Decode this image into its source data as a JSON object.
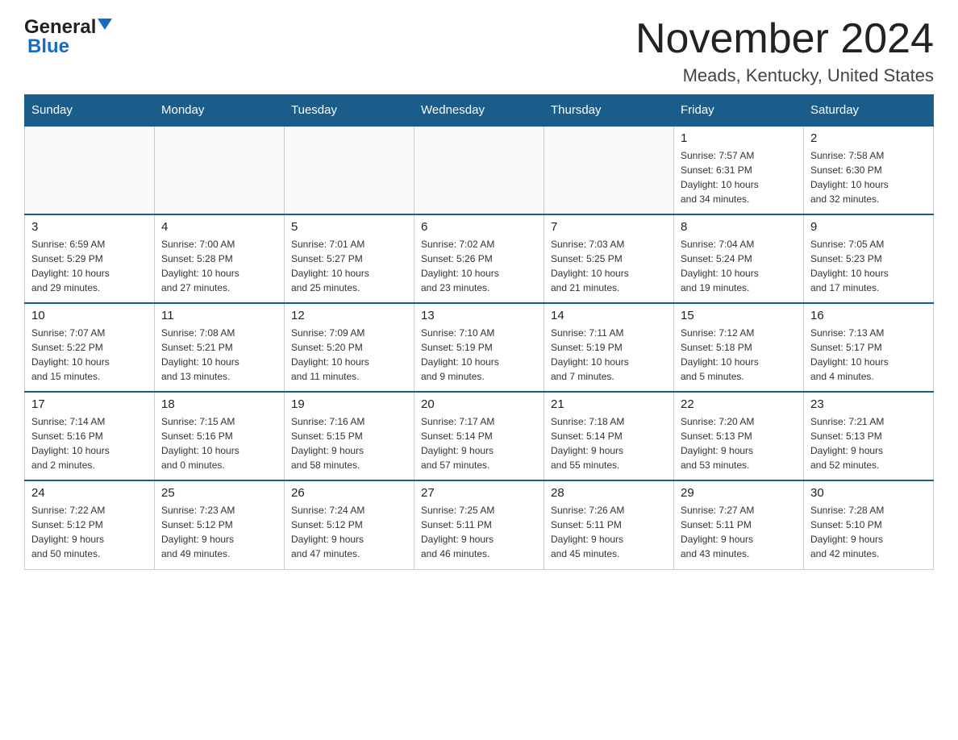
{
  "header": {
    "logo_general": "General",
    "logo_blue": "Blue",
    "main_title": "November 2024",
    "subtitle": "Meads, Kentucky, United States"
  },
  "days_of_week": [
    "Sunday",
    "Monday",
    "Tuesday",
    "Wednesday",
    "Thursday",
    "Friday",
    "Saturday"
  ],
  "weeks": [
    [
      {
        "day": "",
        "info": ""
      },
      {
        "day": "",
        "info": ""
      },
      {
        "day": "",
        "info": ""
      },
      {
        "day": "",
        "info": ""
      },
      {
        "day": "",
        "info": ""
      },
      {
        "day": "1",
        "info": "Sunrise: 7:57 AM\nSunset: 6:31 PM\nDaylight: 10 hours\nand 34 minutes."
      },
      {
        "day": "2",
        "info": "Sunrise: 7:58 AM\nSunset: 6:30 PM\nDaylight: 10 hours\nand 32 minutes."
      }
    ],
    [
      {
        "day": "3",
        "info": "Sunrise: 6:59 AM\nSunset: 5:29 PM\nDaylight: 10 hours\nand 29 minutes."
      },
      {
        "day": "4",
        "info": "Sunrise: 7:00 AM\nSunset: 5:28 PM\nDaylight: 10 hours\nand 27 minutes."
      },
      {
        "day": "5",
        "info": "Sunrise: 7:01 AM\nSunset: 5:27 PM\nDaylight: 10 hours\nand 25 minutes."
      },
      {
        "day": "6",
        "info": "Sunrise: 7:02 AM\nSunset: 5:26 PM\nDaylight: 10 hours\nand 23 minutes."
      },
      {
        "day": "7",
        "info": "Sunrise: 7:03 AM\nSunset: 5:25 PM\nDaylight: 10 hours\nand 21 minutes."
      },
      {
        "day": "8",
        "info": "Sunrise: 7:04 AM\nSunset: 5:24 PM\nDaylight: 10 hours\nand 19 minutes."
      },
      {
        "day": "9",
        "info": "Sunrise: 7:05 AM\nSunset: 5:23 PM\nDaylight: 10 hours\nand 17 minutes."
      }
    ],
    [
      {
        "day": "10",
        "info": "Sunrise: 7:07 AM\nSunset: 5:22 PM\nDaylight: 10 hours\nand 15 minutes."
      },
      {
        "day": "11",
        "info": "Sunrise: 7:08 AM\nSunset: 5:21 PM\nDaylight: 10 hours\nand 13 minutes."
      },
      {
        "day": "12",
        "info": "Sunrise: 7:09 AM\nSunset: 5:20 PM\nDaylight: 10 hours\nand 11 minutes."
      },
      {
        "day": "13",
        "info": "Sunrise: 7:10 AM\nSunset: 5:19 PM\nDaylight: 10 hours\nand 9 minutes."
      },
      {
        "day": "14",
        "info": "Sunrise: 7:11 AM\nSunset: 5:19 PM\nDaylight: 10 hours\nand 7 minutes."
      },
      {
        "day": "15",
        "info": "Sunrise: 7:12 AM\nSunset: 5:18 PM\nDaylight: 10 hours\nand 5 minutes."
      },
      {
        "day": "16",
        "info": "Sunrise: 7:13 AM\nSunset: 5:17 PM\nDaylight: 10 hours\nand 4 minutes."
      }
    ],
    [
      {
        "day": "17",
        "info": "Sunrise: 7:14 AM\nSunset: 5:16 PM\nDaylight: 10 hours\nand 2 minutes."
      },
      {
        "day": "18",
        "info": "Sunrise: 7:15 AM\nSunset: 5:16 PM\nDaylight: 10 hours\nand 0 minutes."
      },
      {
        "day": "19",
        "info": "Sunrise: 7:16 AM\nSunset: 5:15 PM\nDaylight: 9 hours\nand 58 minutes."
      },
      {
        "day": "20",
        "info": "Sunrise: 7:17 AM\nSunset: 5:14 PM\nDaylight: 9 hours\nand 57 minutes."
      },
      {
        "day": "21",
        "info": "Sunrise: 7:18 AM\nSunset: 5:14 PM\nDaylight: 9 hours\nand 55 minutes."
      },
      {
        "day": "22",
        "info": "Sunrise: 7:20 AM\nSunset: 5:13 PM\nDaylight: 9 hours\nand 53 minutes."
      },
      {
        "day": "23",
        "info": "Sunrise: 7:21 AM\nSunset: 5:13 PM\nDaylight: 9 hours\nand 52 minutes."
      }
    ],
    [
      {
        "day": "24",
        "info": "Sunrise: 7:22 AM\nSunset: 5:12 PM\nDaylight: 9 hours\nand 50 minutes."
      },
      {
        "day": "25",
        "info": "Sunrise: 7:23 AM\nSunset: 5:12 PM\nDaylight: 9 hours\nand 49 minutes."
      },
      {
        "day": "26",
        "info": "Sunrise: 7:24 AM\nSunset: 5:12 PM\nDaylight: 9 hours\nand 47 minutes."
      },
      {
        "day": "27",
        "info": "Sunrise: 7:25 AM\nSunset: 5:11 PM\nDaylight: 9 hours\nand 46 minutes."
      },
      {
        "day": "28",
        "info": "Sunrise: 7:26 AM\nSunset: 5:11 PM\nDaylight: 9 hours\nand 45 minutes."
      },
      {
        "day": "29",
        "info": "Sunrise: 7:27 AM\nSunset: 5:11 PM\nDaylight: 9 hours\nand 43 minutes."
      },
      {
        "day": "30",
        "info": "Sunrise: 7:28 AM\nSunset: 5:10 PM\nDaylight: 9 hours\nand 42 minutes."
      }
    ]
  ]
}
